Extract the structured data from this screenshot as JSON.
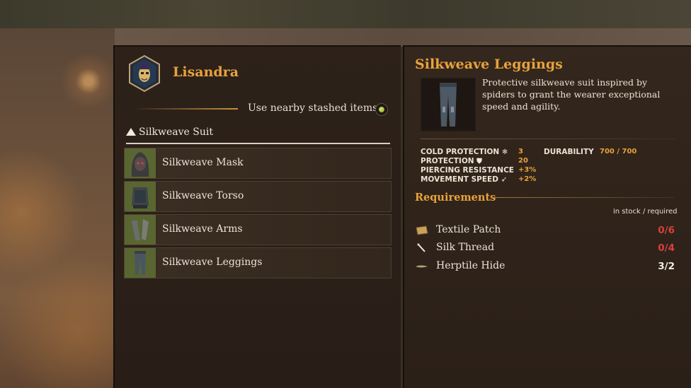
{
  "character": {
    "name": "Lisandra",
    "avatar_icon": "jester-mask-icon"
  },
  "stash": {
    "label": "Use nearby stashed items",
    "enabled": true
  },
  "set": {
    "title": "Silkweave Suit"
  },
  "items": [
    {
      "label": "Silkweave Mask",
      "icon": "mask-icon"
    },
    {
      "label": "Silkweave Torso",
      "icon": "torso-icon"
    },
    {
      "label": "Silkweave Arms",
      "icon": "arms-icon"
    },
    {
      "label": "Silkweave Leggings",
      "icon": "leggings-icon"
    }
  ],
  "detail": {
    "title": "Silkweave Leggings",
    "description": "Protective silkweave suit inspired by spiders to grant the wearer exceptional speed and agility.",
    "stats": [
      {
        "label": "COLD PROTECTION",
        "icon": "snowflake-icon",
        "value": "3"
      },
      {
        "label": "PROTECTION",
        "icon": "shield-icon",
        "value": "20"
      },
      {
        "label": "PIERCING RESISTANCE",
        "icon": "",
        "value": "+3%"
      },
      {
        "label": "MOVEMENT SPEED",
        "icon": "running-icon",
        "value": "+2%"
      }
    ],
    "durability": {
      "label": "DURABILITY",
      "value": "700 / 700"
    }
  },
  "requirements": {
    "title": "Requirements",
    "note": "in stock / required",
    "items": [
      {
        "name": "Textile Patch",
        "count": "0/6",
        "status_color": "#d7403a",
        "icon": "patch-icon"
      },
      {
        "name": "Silk Thread",
        "count": "0/4",
        "status_color": "#d7403a",
        "icon": "thread-icon"
      },
      {
        "name": "Herptile Hide",
        "count": "3/2",
        "status_color": "#f2ece0",
        "icon": "hide-icon"
      }
    ]
  },
  "colors": {
    "accent": "#e8a23c",
    "missing": "#d7403a"
  }
}
